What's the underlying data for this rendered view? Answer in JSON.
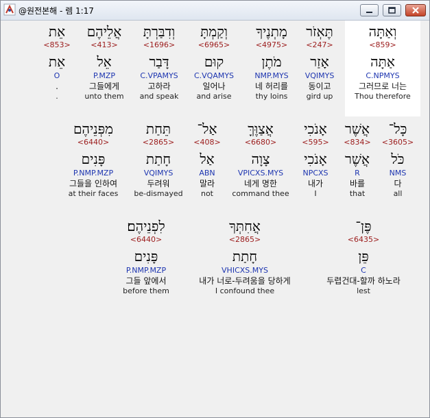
{
  "window": {
    "title": "@원전본해 - 렘 1:17",
    "minimize_icon": "minimize-icon",
    "maximize_icon": "maximize-icon",
    "close_icon": "close-icon"
  },
  "colors": {
    "hebrew": "#000000",
    "strong": "#9b1b1b",
    "parse": "#1d35b0",
    "highlight": "#ffffff"
  },
  "rows": [
    [
      {
        "heb": "וְאַתָּה",
        "num": "<859>",
        "lemma": "אַתָּה",
        "parse": "C.NPMYS",
        "ko": "그러므로 너는",
        "en": "Thou therefore"
      },
      {
        "heb": "תֶּאְזֹר",
        "num": "<247>",
        "lemma": "אָזַר",
        "parse": "VQIMYS",
        "ko": "동이고",
        "en": "gird up"
      },
      {
        "heb": "מָתְנֶיךָ",
        "num": "<4975>",
        "lemma": "מֹתֶן",
        "parse": "NMP.MYS",
        "ko": "네 허리를",
        "en": "thy loins"
      },
      {
        "heb": "וְקַמְתָּ",
        "num": "<6965>",
        "lemma": "קוּם",
        "parse": "C.VQAMYS",
        "ko": "일어나",
        "en": "and arise"
      },
      {
        "heb": "וְדִבַּרְתָּ",
        "num": "<1696>",
        "lemma": "דָּבַר",
        "parse": "C.VPAMYS",
        "ko": "고하라",
        "en": "and speak"
      },
      {
        "heb": "אֲלֵיהֶם",
        "num": "<413>",
        "lemma": "אֵל",
        "parse": "P.MZP",
        "ko": "그들에게",
        "en": "unto them"
      },
      {
        "heb": "אֵת",
        "num": "<853>",
        "lemma": "אֵת",
        "parse": "O",
        "ko": ".",
        "en": "."
      }
    ],
    [
      {
        "heb": "כָּל־",
        "num": "<3605>",
        "lemma": "כֹּל",
        "parse": "NMS",
        "ko": "다",
        "en": "all"
      },
      {
        "heb": "אֲשֶׁר",
        "num": "<834>",
        "lemma": "אֲשֶׁר",
        "parse": "R",
        "ko": "바를",
        "en": "that"
      },
      {
        "heb": "אָנֹכִי",
        "num": "<595>",
        "lemma": "אָנֹכִי",
        "parse": "NPCXS",
        "ko": "내가",
        "en": "I"
      },
      {
        "heb": "אֲצַוֶּךָּ",
        "num": "<6680>",
        "lemma": "צָוָה",
        "parse": "VPICXS.MYS",
        "ko": "네게 명한",
        "en": "command thee"
      },
      {
        "heb": "אַל־",
        "num": "<408>",
        "lemma": "אַל",
        "parse": "ABN",
        "ko": "말라",
        "en": "not"
      },
      {
        "heb": "תֵּחַת",
        "num": "<2865>",
        "lemma": "חָתַת",
        "parse": "VQIMYS",
        "ko": "두려워",
        "en": "be-dismayed"
      },
      {
        "heb": "מִפְּנֵיהֶם",
        "num": "<6440>",
        "lemma": "פָּנִים",
        "parse": "P.NMP.MZP",
        "ko": "그들을 인하여",
        "en": "at their faces"
      }
    ],
    [
      {
        "heb": "פֶּן־",
        "num": "<6435>",
        "lemma": "פֵּן",
        "parse": "C",
        "ko": "두렵건대-할까 하노라",
        "en": "lest"
      },
      {
        "heb": "אֲחִתְּךָ",
        "num": "<2865>",
        "lemma": "חָתַת",
        "parse": "VHICXS.MYS",
        "ko": "내가 너로-두려움을 당하게",
        "en": "I confound thee"
      },
      {
        "heb": "לִפְנֵיהֶם׃",
        "num": "<6440>",
        "lemma": "פָּנִים",
        "parse": "P.NMP.MZP",
        "ko": "그들 앞에서",
        "en": "before them"
      }
    ]
  ]
}
